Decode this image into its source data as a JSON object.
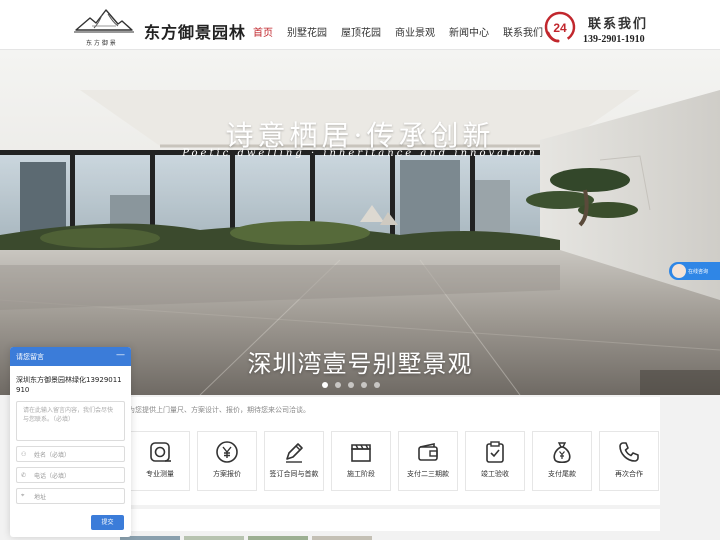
{
  "header": {
    "brand": "东方御景园林",
    "nav": [
      "首页",
      "别墅花园",
      "屋顶花园",
      "商业景观",
      "新闻中心",
      "联系我们"
    ],
    "active_nav": "首页",
    "contact_badge": "24",
    "contact_title": "联系我们",
    "contact_phone": "139-2901-1910"
  },
  "banner": {
    "title": "诗意栖居·传承创新",
    "subtitle": "Poetic dwelling · inheritance and innovation",
    "caption": "深圳湾壹号别墅景观",
    "slide_count": 5,
    "active_slide": 0
  },
  "process": {
    "intro": "为您提供上门量尺、方案设计、报价，期待您来公司洽谈。",
    "steps": [
      {
        "label": "专业测量",
        "icon": "tape-measure-icon"
      },
      {
        "label": "方案报价",
        "icon": "yen-coin-icon"
      },
      {
        "label": "签订合同与首款",
        "icon": "pen-icon"
      },
      {
        "label": "施工阶段",
        "icon": "clapboard-icon"
      },
      {
        "label": "支付二三期款",
        "icon": "wallet-icon"
      },
      {
        "label": "竣工验收",
        "icon": "clipboard-check-icon"
      },
      {
        "label": "支付尾款",
        "icon": "money-bag-icon"
      },
      {
        "label": "再次合作",
        "icon": "phone-icon"
      }
    ]
  },
  "chat": {
    "title": "请您留言",
    "minimize": "—",
    "message": "深圳东方御景园林绿化13929011910",
    "textarea_placeholder": "请在此输入留言内容，我们会尽快与您联系。（必填）",
    "name_placeholder": "姓名（必填）",
    "phone_placeholder": "电话（必填）",
    "address_placeholder": "地址",
    "submit": "提交"
  },
  "online_service": "在线咨询",
  "colors": {
    "accent_red": "#c1272d",
    "chat_blue": "#3b7cd9",
    "online_blue": "#2f86e6"
  }
}
